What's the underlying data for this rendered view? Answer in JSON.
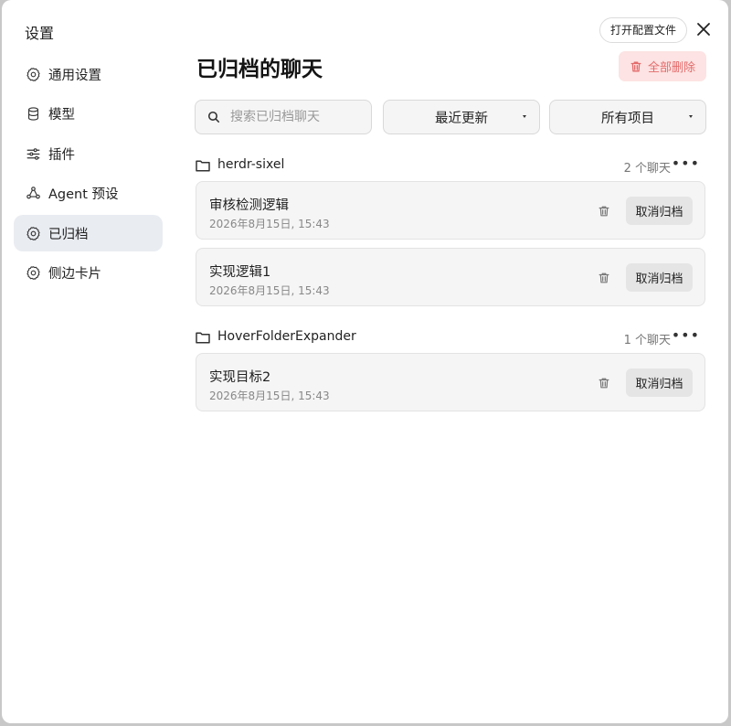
{
  "sidebar": {
    "title": "设置",
    "items": [
      {
        "label": "通用设置",
        "icon": "gear-icon"
      },
      {
        "label": "模型",
        "icon": "database-icon"
      },
      {
        "label": "插件",
        "icon": "sliders-icon"
      },
      {
        "label": "Agent 预设",
        "icon": "agent-icon"
      },
      {
        "label": "已归档",
        "icon": "gear-icon",
        "active": true
      },
      {
        "label": "侧边卡片",
        "icon": "gear-icon"
      }
    ]
  },
  "header": {
    "open_config_label": "打开配置文件",
    "title": "已归档的聊天",
    "delete_all_label": "全部删除"
  },
  "toolbar": {
    "search_placeholder": "搜索已归档聊天",
    "sort_value": "最近更新",
    "scope_value": "所有项目"
  },
  "groups": [
    {
      "name": "herdr-sixel",
      "count_label": "2 个聊天",
      "chats": [
        {
          "title": "审核检测逻辑",
          "date": "2026年8月15日, 15:43",
          "unarchive_label": "取消归档"
        },
        {
          "title": "实现逻辑1",
          "date": "2026年8月15日, 15:43",
          "unarchive_label": "取消归档"
        }
      ]
    },
    {
      "name": "HoverFolderExpander",
      "count_label": "1 个聊天",
      "chats": [
        {
          "title": "实现目标2",
          "date": "2026年8月15日, 15:43",
          "unarchive_label": "取消归档"
        }
      ]
    }
  ],
  "colors": {
    "active_item_bg": "#e9ecf1",
    "danger_bg": "#fde3e3",
    "danger_text": "#e36b6b",
    "card_bg": "#f5f5f5"
  }
}
